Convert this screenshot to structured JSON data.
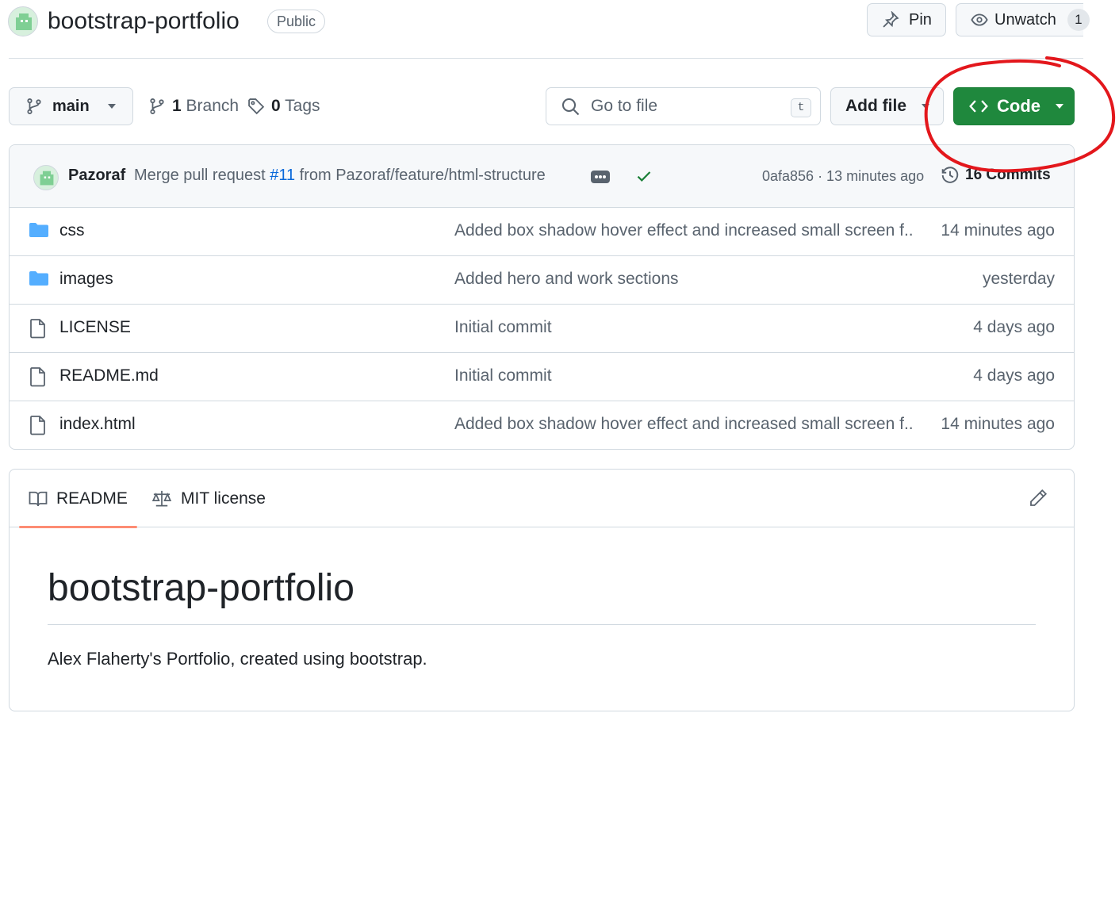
{
  "repo": {
    "name": "bootstrap-portfolio",
    "visibility": "Public"
  },
  "actions": {
    "pin_label": "Pin",
    "unwatch_label": "Unwatch",
    "watch_count": "1"
  },
  "toolbar": {
    "branch": "main",
    "branches_count": "1",
    "branches_label": "Branch",
    "tags_count": "0",
    "tags_label": "Tags",
    "search_placeholder": "Go to file",
    "search_shortcut": "t",
    "add_file_label": "Add file",
    "code_label": "Code"
  },
  "latest_commit": {
    "author": "Pazoraf",
    "message_prefix": "Merge pull request ",
    "pr_link": "#11",
    "message_suffix": " from Pazoraf/feature/html-structure",
    "sha_and_time": "0afa856 · 13 minutes ago",
    "commits_label": "16 Commits"
  },
  "files": [
    {
      "name": "css",
      "type": "folder",
      "message": "Added box shadow hover effect and increased small screen f...",
      "age": "14 minutes ago"
    },
    {
      "name": "images",
      "type": "folder",
      "message": "Added hero and work sections",
      "age": "yesterday"
    },
    {
      "name": "LICENSE",
      "type": "file",
      "message": "Initial commit",
      "age": "4 days ago"
    },
    {
      "name": "README.md",
      "type": "file",
      "message": "Initial commit",
      "age": "4 days ago"
    },
    {
      "name": "index.html",
      "type": "file",
      "message": "Added box shadow hover effect and increased small screen f...",
      "age": "14 minutes ago"
    }
  ],
  "readme": {
    "tabs": [
      "README",
      "MIT license"
    ],
    "title": "bootstrap-portfolio",
    "description": "Alex Flaherty's Portfolio, created using bootstrap."
  },
  "colors": {
    "primary_button": "#1f883d",
    "link": "#0969da",
    "folder_icon": "#54aeff",
    "active_tab_underline": "#fd8c73",
    "annotation_circle": "#e3171c",
    "success_check": "#1a7f37"
  },
  "icons": {
    "pin": "pin-icon",
    "watch": "eye-icon",
    "branch": "git-branch-icon",
    "tag": "tag-icon",
    "search": "search-icon",
    "code": "code-icon",
    "history": "history-icon",
    "folder": "folder-icon",
    "file": "file-icon",
    "book": "book-icon",
    "law": "law-icon",
    "edit": "pencil-icon"
  }
}
